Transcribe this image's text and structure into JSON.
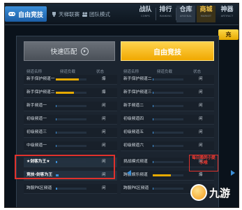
{
  "topnav": {
    "active_tab": "自由竞技",
    "subtabs": [
      "天梯联赛",
      "团队模式"
    ],
    "items": [
      {
        "zh": "战队",
        "en": "CORPS"
      },
      {
        "zh": "排行",
        "en": "RANKING"
      },
      {
        "zh": "仓库",
        "en": "ARSENAL"
      },
      {
        "zh": "商城",
        "en": "MARKET"
      },
      {
        "zh": "神器",
        "en": "ARTIFACT"
      }
    ]
  },
  "recharge_label": "充",
  "modes": {
    "quick": "快速匹配",
    "free": "自由竞技"
  },
  "headers": {
    "name": "频道名称",
    "load": "频道负载",
    "status": "状态"
  },
  "left_channels": [
    {
      "name": "新手保护频道一",
      "load": 0.75,
      "color": "#e5a900",
      "status": "爆"
    },
    {
      "name": "新手保护频道二",
      "load": 0.6,
      "color": "#e5a900",
      "status": "爆"
    },
    {
      "name": "新手频道一",
      "load": 0.02,
      "color": "#3d8fd6",
      "status": "闲"
    },
    {
      "name": "初级频道一",
      "load": 0.02,
      "color": "#3d8fd6",
      "status": "闲"
    },
    {
      "name": "初级频道三",
      "load": 0.02,
      "color": "#3d8fd6",
      "status": "闲"
    },
    {
      "name": "中级频道一",
      "load": 0.02,
      "color": "#3d8fd6",
      "status": "闲"
    },
    {
      "name": "★剑客为王★",
      "load": 0.05,
      "color": "#3d8fd6",
      "status": "闲"
    },
    {
      "name": "竞技-剑客为王",
      "load": 0.08,
      "color": "#3d8fd6",
      "status": "闲"
    },
    {
      "name": "跨服PK区频道",
      "load": 0.05,
      "color": "#3d8fd6",
      "status": "闲"
    }
  ],
  "right_channels": [
    {
      "name": "新手保护频道二",
      "load": 0.02,
      "color": "#3d8fd6",
      "status": "闲"
    },
    {
      "name": "新手保护频道三",
      "load": 0.02,
      "color": "#3d8fd6",
      "status": "闲"
    },
    {
      "name": "新手频道二",
      "load": 0.02,
      "color": "#3d8fd6",
      "status": "闲"
    },
    {
      "name": "初级频道四",
      "load": 0.02,
      "color": "#3d8fd6",
      "status": "闲"
    },
    {
      "name": "初级频道五",
      "load": 0.02,
      "color": "#3d8fd6",
      "status": "闲"
    },
    {
      "name": "初级频道六",
      "load": 0.02,
      "color": "#3d8fd6",
      "status": "闲"
    },
    {
      "name": "挑战模式频道",
      "load": 0.02,
      "color": "#3d8fd6",
      "status": "闲"
    },
    {
      "name": "跨服娱乐频道",
      "load": 0.6,
      "color": "#e5a900",
      "status": "爆"
    },
    {
      "name": "跨服PK区频道",
      "load": 0.02,
      "color": "#3d8fd6",
      "status": "闲"
    }
  ],
  "annotation": "每日晚的小提示哦",
  "watermark": "九游"
}
